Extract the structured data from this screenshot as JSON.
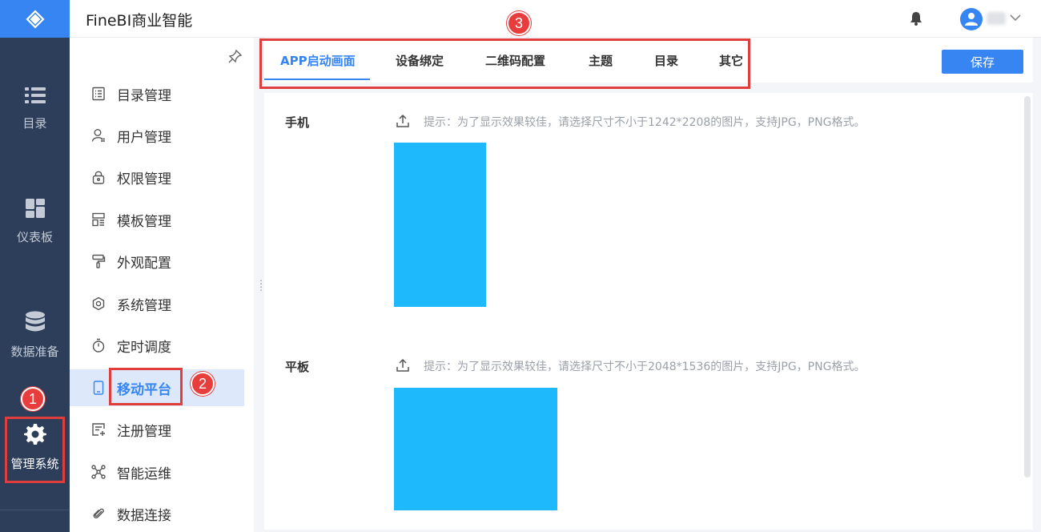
{
  "app_title": "FineBI商业智能",
  "rail": {
    "items": [
      {
        "label": "目录",
        "icon": "list-icon"
      },
      {
        "label": "仪表板",
        "icon": "dashboard-icon"
      },
      {
        "label": "数据准备",
        "icon": "database-icon"
      },
      {
        "label": "管理系统",
        "icon": "gear-icon",
        "active": true
      }
    ]
  },
  "subnav": {
    "items": [
      {
        "label": "目录管理",
        "icon": "catalog-icon"
      },
      {
        "label": "用户管理",
        "icon": "user-icon"
      },
      {
        "label": "权限管理",
        "icon": "lock-icon"
      },
      {
        "label": "模板管理",
        "icon": "template-icon"
      },
      {
        "label": "外观配置",
        "icon": "paint-roller-icon"
      },
      {
        "label": "系统管理",
        "icon": "settings-icon"
      },
      {
        "label": "定时调度",
        "icon": "timer-icon"
      },
      {
        "label": "移动平台",
        "icon": "mobile-icon",
        "active": true
      },
      {
        "label": "注册管理",
        "icon": "register-icon"
      },
      {
        "label": "智能运维",
        "icon": "network-icon"
      },
      {
        "label": "数据连接",
        "icon": "paperclip-icon"
      }
    ]
  },
  "tabs": [
    {
      "label": "APP启动画面",
      "active": true
    },
    {
      "label": "设备绑定"
    },
    {
      "label": "二维码配置"
    },
    {
      "label": "主题"
    },
    {
      "label": "目录"
    },
    {
      "label": "其它"
    }
  ],
  "save_label": "保存",
  "sections": [
    {
      "label": "手机",
      "hint": "提示：为了显示效果较佳，请选择尺寸不小于1242*2208的图片，支持JPG，PNG格式。"
    },
    {
      "label": "平板",
      "hint": "提示：为了显示效果较佳，请选择尺寸不小于2048*1536的图片，支持JPG，PNG格式。"
    }
  ],
  "annotations": [
    "1",
    "2",
    "3"
  ],
  "colors": {
    "accent": "#3685f2",
    "rail": "#2c3e5a",
    "preview": "#1eb8fd",
    "annotation": "#e03d3d"
  }
}
